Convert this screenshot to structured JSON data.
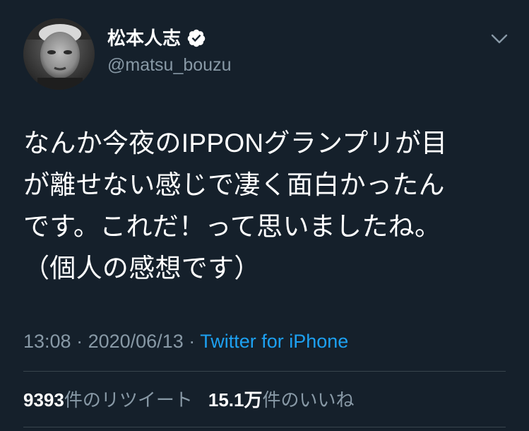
{
  "user": {
    "display_name": "松本人志",
    "handle": "@matsu_bouzu",
    "verified": true
  },
  "tweet": {
    "lines": [
      "なんか今夜のIPPONグランプリが目",
      "が離せない感じで凄く面白かったん",
      "です。これだ！って思いましたね。",
      "（個人の感想です）"
    ]
  },
  "meta": {
    "time": "13:08",
    "separator": " · ",
    "date": "2020/06/13",
    "source": "Twitter for iPhone"
  },
  "stats": {
    "retweets_count": "9393",
    "retweets_label": "件のリツイート",
    "likes_count": "15.1万",
    "likes_label": "件のいいね"
  },
  "colors": {
    "background": "#15202b",
    "text_primary": "#ffffff",
    "text_secondary": "#8899a6",
    "link": "#1da1f2",
    "divider": "#38444d"
  },
  "icons": {
    "verified": "verified-badge-icon",
    "menu": "chevron-down-icon"
  }
}
